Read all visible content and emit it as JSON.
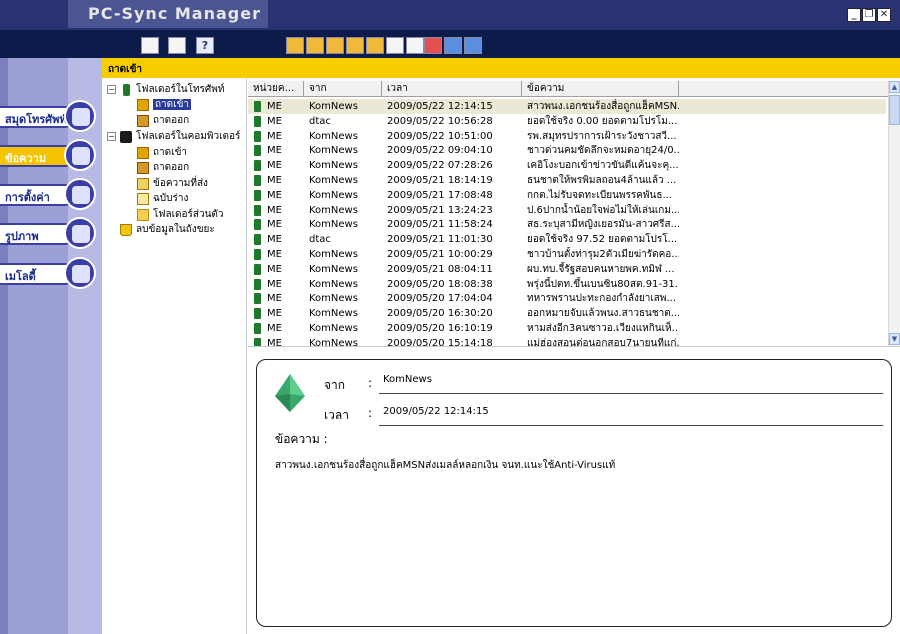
{
  "app": {
    "title": "PC-Sync Manager"
  },
  "window_controls": {
    "minimize": "_",
    "restore": "❐",
    "close": "✕"
  },
  "toolbar": {
    "left_icons": [
      "document-icon",
      "edit-icon",
      "help-icon"
    ],
    "help_label": "?",
    "right_icons": [
      "new-message-icon",
      "open-envelope-icon",
      "send-icon",
      "reply-icon",
      "forward-icon",
      "copy-icon",
      "move-icon",
      "delete-icon",
      "sync-icon",
      "info-icon"
    ]
  },
  "nav": {
    "items": [
      {
        "label": "สมุดโทรศัพท์",
        "icon": "phonebook-icon",
        "active": false
      },
      {
        "label": "ข้อความ",
        "icon": "envelope-icon",
        "active": true
      },
      {
        "label": "การตั้งค่า",
        "icon": "settings-icon",
        "active": false
      },
      {
        "label": "รูปภาพ",
        "icon": "picture-icon",
        "active": false
      },
      {
        "label": "เมโลดี้",
        "icon": "music-icon",
        "active": false
      }
    ]
  },
  "header": {
    "title": "ถาดเข้า"
  },
  "tree": {
    "phone_folder": "โฟลเดอร์ในโทรศัพท์",
    "phone_inbox": "ถาดเข้า",
    "phone_outbox": "ถาดออก",
    "pc_folder": "โฟลเดอร์ในคอมพิวเตอร์",
    "pc_inbox": "ถาดเข้า",
    "pc_outbox": "ถาดออก",
    "pc_sent": "ข้อความที่ส่ง",
    "pc_drafts": "ฉบับร่าง",
    "pc_personal": "โฟลเดอร์ส่วนตัว",
    "trash": "ลบข้อมูลในถังขยะ"
  },
  "list": {
    "columns": [
      "หน่วยค...",
      "จาก",
      "เวลา",
      "ข้อความ"
    ],
    "rows": [
      {
        "unit": "ME",
        "from": "KomNews",
        "time": "2009/05/22 12:14:15",
        "text": "สาวพนง.เอกชนร้องสื่อถูกแฮ็คMSN..."
      },
      {
        "unit": "ME",
        "from": "dtac",
        "time": "2009/05/22 10:56:28",
        "text": "ยอดใช้จริง 0.00 ยอดตามโปรโม..."
      },
      {
        "unit": "ME",
        "from": "KomNews",
        "time": "2009/05/22 10:51:00",
        "text": "รพ.สมุทรปราการเฝ้าระวังชาวสวี..."
      },
      {
        "unit": "ME",
        "from": "KomNews",
        "time": "2009/05/22 09:04:10",
        "text": "ชาวด่วนคมชัดลึกจะหมดอายุ24/0..."
      },
      {
        "unit": "ME",
        "from": "KomNews",
        "time": "2009/05/22 07:28:26",
        "text": "เคอิโงะบอกเข้าข่าวขันดีแค้นจะคุ..."
      },
      {
        "unit": "ME",
        "from": "KomNews",
        "time": "2009/05/21 18:14:19",
        "text": "ธนชาตให้พรพิมลถอน4ล้านแล้ว ..."
      },
      {
        "unit": "ME",
        "from": "KomNews",
        "time": "2009/05/21 17:08:48",
        "text": "กกต.ไม่รับจดทะเบียนพรรคพันธ..."
      },
      {
        "unit": "ME",
        "from": "KomNews",
        "time": "2009/05/21 13:24:23",
        "text": "ป.6ปากน้ำน้อยใจพ่อไม่ให้เล่นเกม..."
      },
      {
        "unit": "ME",
        "from": "KomNews",
        "time": "2009/05/21 11:58:24",
        "text": "สธ.ระบุสามีหญิงเยอรมัน-สาวศรีส..."
      },
      {
        "unit": "ME",
        "from": "dtac",
        "time": "2009/05/21 11:01:30",
        "text": "ยอดใช้จริง 97.52 ยอดตามโปรโ..."
      },
      {
        "unit": "ME",
        "from": "KomNews",
        "time": "2009/05/21 10:00:29",
        "text": "ชาวบ้านตั้งท่ารุม2ตัวเมียฆ่ารัดคอ..."
      },
      {
        "unit": "ME",
        "from": "KomNews",
        "time": "2009/05/21 08:04:11",
        "text": "ผบ.ทบ.จี้รัฐสอบคนหายพค.ทมิฬ ..."
      },
      {
        "unit": "ME",
        "from": "KomNews",
        "time": "2009/05/20 18:08:38",
        "text": "พรุ่งนี้ปตท.ขึ้นเบนซิน80สต.91-31..."
      },
      {
        "unit": "ME",
        "from": "KomNews",
        "time": "2009/05/20 17:04:04",
        "text": "ทหารพรานปะทะกองกำลังยาเสพ..."
      },
      {
        "unit": "ME",
        "from": "KomNews",
        "time": "2009/05/20 16:30:20",
        "text": "ออกหมายจับแล้วพนง.สาวธนชาต..."
      },
      {
        "unit": "ME",
        "from": "KomNews",
        "time": "2009/05/20 16:10:19",
        "text": "หามส่งอีก3คนซาวอ.เวียงแหกินเห็..."
      },
      {
        "unit": "ME",
        "from": "KomNews",
        "time": "2009/05/20 15:14:18",
        "text": "แม่ฮ่องสอนต่อนอกสอบ7นายนทีแก่..."
      }
    ]
  },
  "detail": {
    "from_label": "จาก",
    "from_value": "KomNews",
    "time_label": "เวลา",
    "time_value": "2009/05/22 12:14:15",
    "message_label": "ข้อความ :",
    "colon": ":",
    "body": "สาวพนง.เอกชนร้องสื่อถูกแฮ็คMSNส่งเมลล์หลอกเงิน จนท.แนะใช้Anti-Virusแท้"
  },
  "colors": {
    "titlebar": "#2a3372",
    "toolbar": "#0d1b4a",
    "accent_yellow": "#f7cc00",
    "nav_bg": "#9da0d6",
    "selected_row": "#ece8d6"
  }
}
